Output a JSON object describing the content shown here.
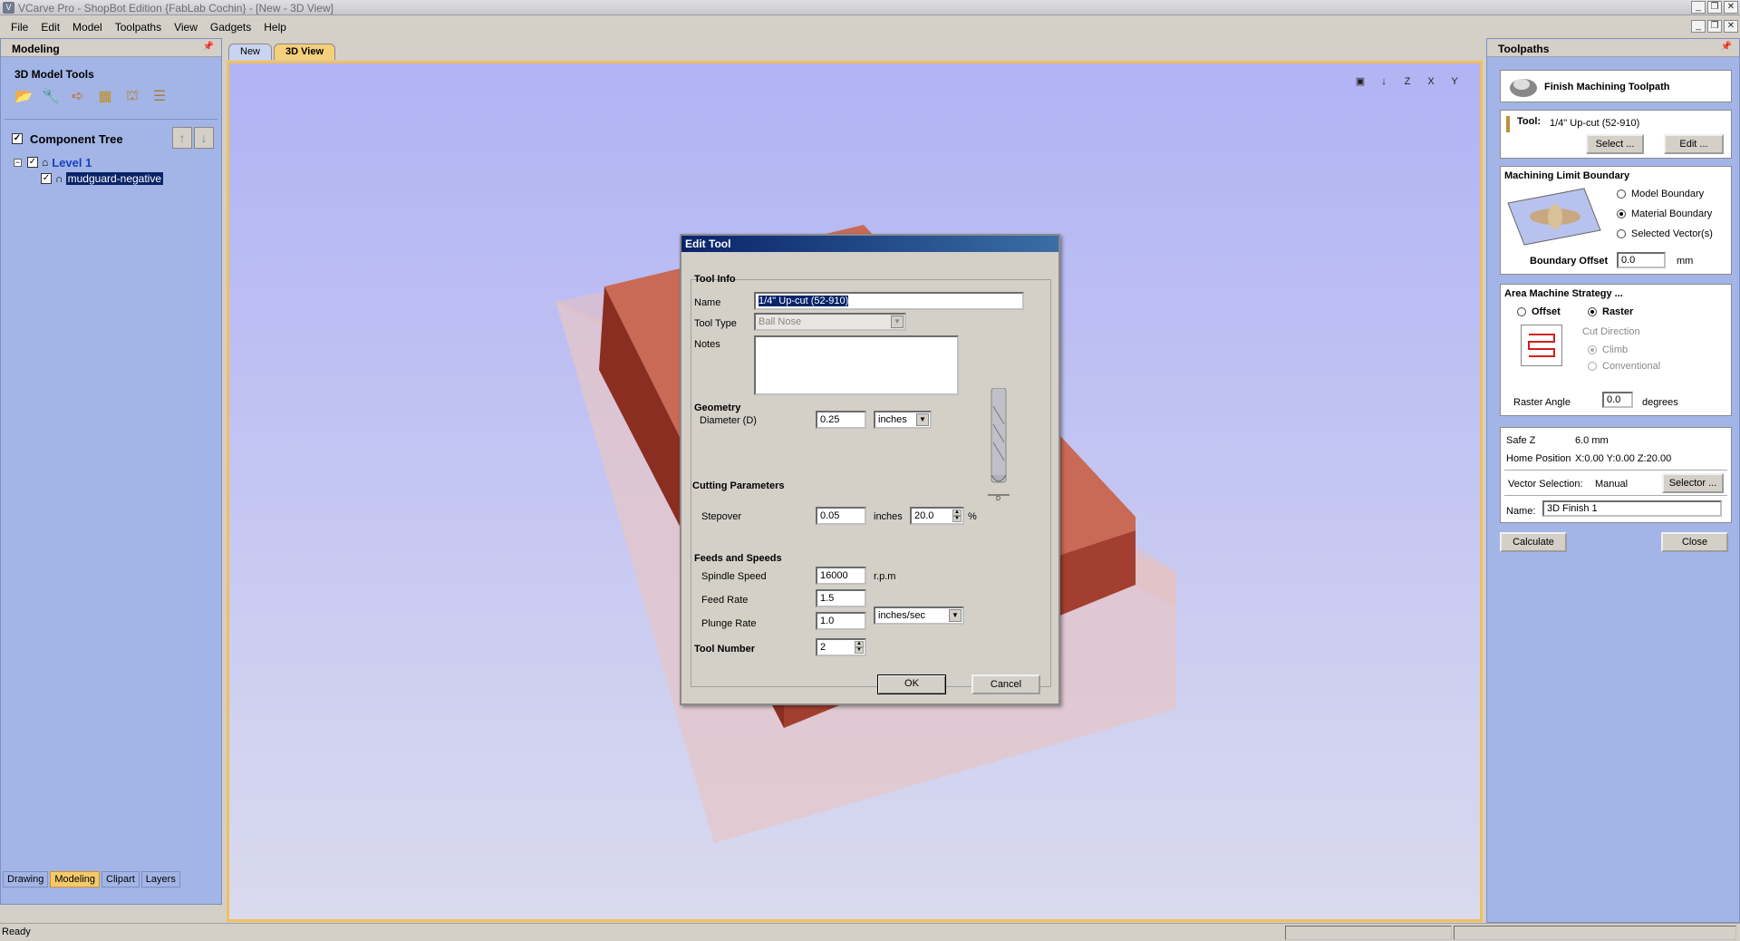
{
  "window": {
    "title": "VCarve Pro - ShopBot Edition {FabLab Cochin} - [New - 3D View]",
    "app_icon": "V"
  },
  "menu": [
    "File",
    "Edit",
    "Model",
    "Toolpaths",
    "View",
    "Gadgets",
    "Help"
  ],
  "left_panel": {
    "header": "Modeling",
    "tools_title": "3D Model Tools",
    "component_tree_label": "Component Tree",
    "tree": {
      "level_label": "Level 1",
      "item_label": "mudguard-negative"
    },
    "bottom_tabs": [
      "Drawing",
      "Modeling",
      "Clipart",
      "Layers"
    ]
  },
  "doc_tabs": [
    "New",
    "3D View"
  ],
  "view_icons": [
    "▣",
    "↓",
    "Z",
    "X",
    "Y"
  ],
  "dialog": {
    "title": "Edit Tool",
    "tool_info": "Tool Info",
    "name_label": "Name",
    "name_value": "1/4\" Up-cut (52-910)",
    "tool_type_label": "Tool Type",
    "tool_type_value": "Ball Nose",
    "notes_label": "Notes",
    "geometry": "Geometry",
    "diameter_label": "Diameter (D)",
    "diameter_value": "0.25",
    "diameter_unit": "inches",
    "cutting_params": "Cutting Parameters",
    "stepover_label": "Stepover",
    "stepover_value": "0.05",
    "stepover_unit": "inches",
    "stepover_pct": "20.0",
    "pct": "%",
    "feeds": "Feeds and Speeds",
    "spindle_label": "Spindle Speed",
    "spindle_value": "16000",
    "spindle_unit": "r.p.m",
    "feed_label": "Feed Rate",
    "feed_value": "1.5",
    "plunge_label": "Plunge Rate",
    "plunge_value": "1.0",
    "rate_unit": "inches/sec",
    "tool_number_label": "Tool Number",
    "tool_number_value": "2",
    "diagram_dim": "D",
    "ok": "OK",
    "cancel": "Cancel"
  },
  "right_panel": {
    "header": "Toolpaths",
    "toolpath_title": "Finish Machining Toolpath",
    "tool_label": "Tool:",
    "tool_value": "1/4\" Up-cut (52-910)",
    "select_btn": "Select ...",
    "edit_btn": "Edit ...",
    "mlb_title": "Machining Limit Boundary",
    "model_boundary": "Model Boundary",
    "material_boundary": "Material Boundary",
    "selected_vectors": "Selected Vector(s)",
    "boundary_offset_label": "Boundary Offset",
    "boundary_offset_value": "0.0",
    "boundary_offset_unit": "mm",
    "strategy_title": "Area Machine Strategy ...",
    "offset": "Offset",
    "raster": "Raster",
    "cut_direction": "Cut Direction",
    "climb": "Climb",
    "conventional": "Conventional",
    "raster_angle_label": "Raster Angle",
    "raster_angle_value": "0.0",
    "raster_angle_unit": "degrees",
    "safe_z_label": "Safe Z",
    "safe_z_value": "6.0 mm",
    "home_label": "Home Position",
    "home_value": "X:0.00 Y:0.00 Z:20.00",
    "vector_sel_label": "Vector Selection:",
    "vector_sel_value": "Manual",
    "selector_btn": "Selector ...",
    "name_label": "Name:",
    "name_value": "3D Finish 1",
    "calculate_btn": "Calculate",
    "close_btn": "Close"
  },
  "status": "Ready"
}
